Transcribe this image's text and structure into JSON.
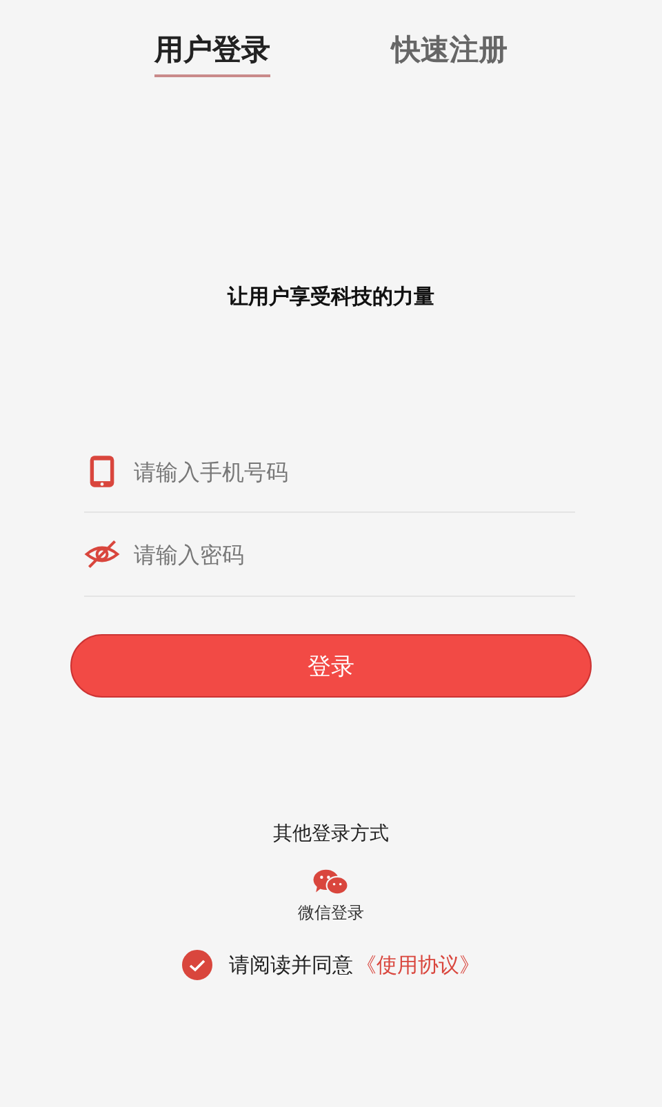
{
  "tabs": [
    {
      "label": "用户登录",
      "selected": true
    },
    {
      "label": "快速注册",
      "selected": false
    }
  ],
  "tagline": "让用户享受科技的力量",
  "fields": [
    {
      "kind": "phone",
      "placeholder": "请输入手机号码"
    },
    {
      "kind": "password",
      "placeholder": "请输入密码"
    }
  ],
  "login_button": "登录",
  "other_methods": {
    "title": "其他登录方式",
    "options": [
      {
        "kind": "wechat",
        "label": "微信登录"
      }
    ]
  },
  "agreement": {
    "checked": true,
    "text": "请阅读并同意",
    "link": "《使用协议》"
  }
}
